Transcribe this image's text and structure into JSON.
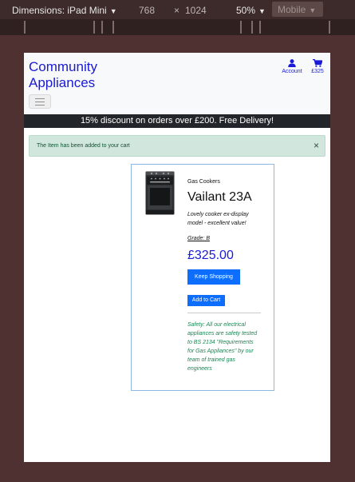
{
  "devtools": {
    "dimensions_label": "Dimensions: iPad Mini",
    "width": "768",
    "times": "×",
    "height": "1024",
    "zoom": "50%",
    "mode": "Mobile"
  },
  "header": {
    "brand": "Community Appliances",
    "account_label": "Account",
    "cart_total": "£325",
    "account_icon": "person-icon",
    "cart_icon": "shopping-cart-icon"
  },
  "promo": {
    "text": "15% discount on orders over £200. Free Delivery!"
  },
  "alert": {
    "message": "The Item has been added to your cart",
    "close_glyph": "×"
  },
  "product": {
    "category": "Gas Cookers",
    "title": "Vailant 23A",
    "description": "Lovely cooker ex-display model - excellent value!",
    "grade": "Grade: B",
    "price": "£325.00",
    "keep_shopping_label": "Keep Shopping",
    "add_to_cart_label": "Add to Cart",
    "safety_note": "Safety: All our electrical appliances are safety tested to BS 2134 \"Requirements for Gas Appliances\" by our team of trained gas engineers"
  },
  "colors": {
    "brand_blue": "#1a1ad6",
    "button_blue": "#0d6efd",
    "success_green": "#198754",
    "alert_bg": "#d1e7dd",
    "promo_bg": "#222529",
    "devtools_bg": "#4e3130"
  }
}
